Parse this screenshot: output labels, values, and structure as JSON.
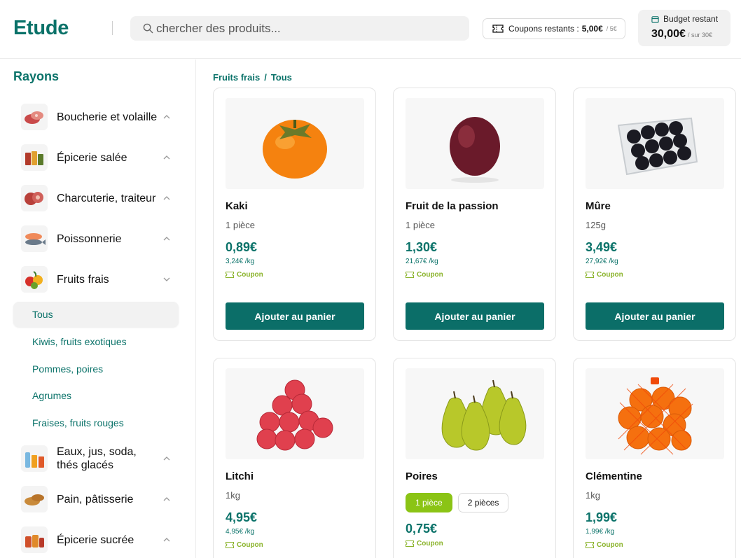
{
  "header": {
    "logo": "Etude",
    "search_placeholder": "chercher des produits...",
    "coupons_label": "Coupons restants :",
    "coupons_value": "5,00€",
    "coupons_cap": "/ 5€",
    "budget_label": "Budget restant",
    "budget_value": "30,00€",
    "budget_cap": "/ sur 30€"
  },
  "sidebar": {
    "title": "Rayons",
    "categories": [
      {
        "label": "Boucherie et volaille",
        "icon": "meat-icon"
      },
      {
        "label": "Épicerie salée",
        "icon": "jars-icon"
      },
      {
        "label": "Charcuterie, traiteur",
        "icon": "charcuterie-icon"
      },
      {
        "label": "Poissonnerie",
        "icon": "fish-icon"
      },
      {
        "label": "Fruits frais",
        "icon": "fruits-icon"
      },
      {
        "label": "Eaux, jus, soda, thés glacés",
        "icon": "bottles-icon"
      },
      {
        "label": "Pain, pâtisserie",
        "icon": "bread-icon"
      },
      {
        "label": "Épicerie sucrée",
        "icon": "sweets-icon"
      }
    ],
    "subcategories": [
      {
        "label": "Tous",
        "active": true
      },
      {
        "label": "Kiwis, fruits exotiques"
      },
      {
        "label": "Pommes, poires"
      },
      {
        "label": "Agrumes"
      },
      {
        "label": "Fraises, fruits rouges"
      }
    ]
  },
  "breadcrumb": {
    "parent": "Fruits frais",
    "separator": "/",
    "current": "Tous"
  },
  "products": [
    {
      "name": "Kaki",
      "unit": "1 pièce",
      "price": "0,89€",
      "per_kg": "3,24€ /kg",
      "coupon": "Coupon",
      "button": "Ajouter au panier",
      "icon": "persimmon-icon"
    },
    {
      "name": "Fruit de la passion",
      "unit": "1 pièce",
      "price": "1,30€",
      "per_kg": "21,67€ /kg",
      "coupon": "Coupon",
      "button": "Ajouter au panier",
      "icon": "passion-fruit-icon"
    },
    {
      "name": "Mûre",
      "unit": "125g",
      "price": "3,49€",
      "per_kg": "27,92€ /kg",
      "coupon": "Coupon",
      "button": "Ajouter au panier",
      "icon": "blackberry-icon"
    },
    {
      "name": "Litchi",
      "unit": "1kg",
      "price": "4,95€",
      "per_kg": "4,95€ /kg",
      "coupon": "Coupon",
      "icon": "lychee-icon"
    },
    {
      "name": "Poires",
      "variants": [
        "1 pièce",
        "2 pièces"
      ],
      "price": "0,75€",
      "coupon": "Coupon",
      "icon": "pear-icon"
    },
    {
      "name": "Clémentine",
      "unit": "1kg",
      "price": "1,99€",
      "per_kg": "1,99€ /kg",
      "coupon": "Coupon",
      "icon": "clementine-icon"
    }
  ],
  "colors": {
    "brand": "#0a7269",
    "button": "#0b6e68",
    "coupon": "#8ab32a",
    "variant_selected": "#8bc415"
  }
}
